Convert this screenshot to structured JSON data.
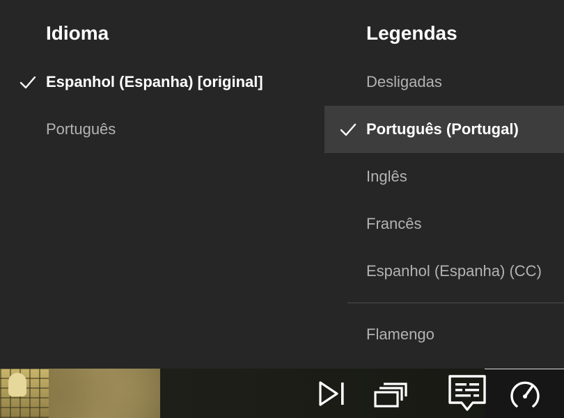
{
  "audio": {
    "title": "Idioma",
    "options": [
      {
        "label": "Espanhol (Espanha) [original]",
        "selected": true
      },
      {
        "label": "Português",
        "selected": false
      }
    ]
  },
  "subtitles": {
    "title": "Legendas",
    "options": [
      {
        "label": "Desligadas",
        "selected": false
      },
      {
        "label": "Português (Portugal)",
        "selected": true
      },
      {
        "label": "Inglês",
        "selected": false
      },
      {
        "label": "Francês",
        "selected": false
      },
      {
        "label": "Espanhol (Espanha) (CC)",
        "selected": false
      }
    ],
    "more_options": [
      {
        "label": "Flamengo",
        "selected": false
      }
    ]
  },
  "player_controls": {
    "icons": [
      "next-episode-icon",
      "episodes-icon",
      "audio-subtitles-icon",
      "playback-speed-icon"
    ]
  },
  "colors": {
    "panel_bg": "#262626",
    "highlight_bg": "#3d3d3d",
    "selected_text": "#ffffff",
    "option_text": "#b3b3b3"
  }
}
